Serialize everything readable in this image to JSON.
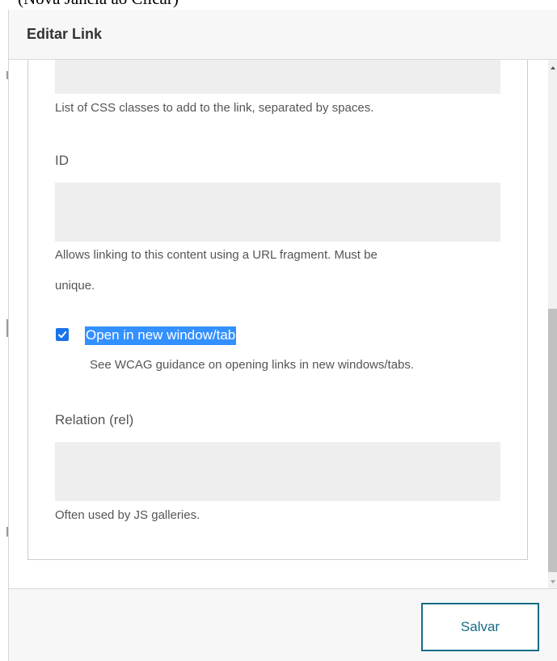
{
  "page_top_clip": "(Nova Janela ao Clicar)",
  "dialog": {
    "title": "Editar Link"
  },
  "form": {
    "css_classes_help": "List of CSS classes to add to the link, separated by spaces.",
    "id_label": "ID",
    "id_value": "",
    "id_help_line1": "Allows linking to this content using a URL fragment. Must be",
    "id_help_line2": "unique.",
    "new_window_checked": true,
    "new_window_label": "Open in new window/tab",
    "new_window_help": "See WCAG guidance on opening links in new windows/tabs.",
    "rel_label": "Relation (rel)",
    "rel_value": "",
    "rel_help": "Often used by JS galleries."
  },
  "footer": {
    "save_label": "Salvar"
  },
  "colors": {
    "accent": "#176b87",
    "checkbox": "#1a73e8",
    "selection": "#3390ff"
  }
}
